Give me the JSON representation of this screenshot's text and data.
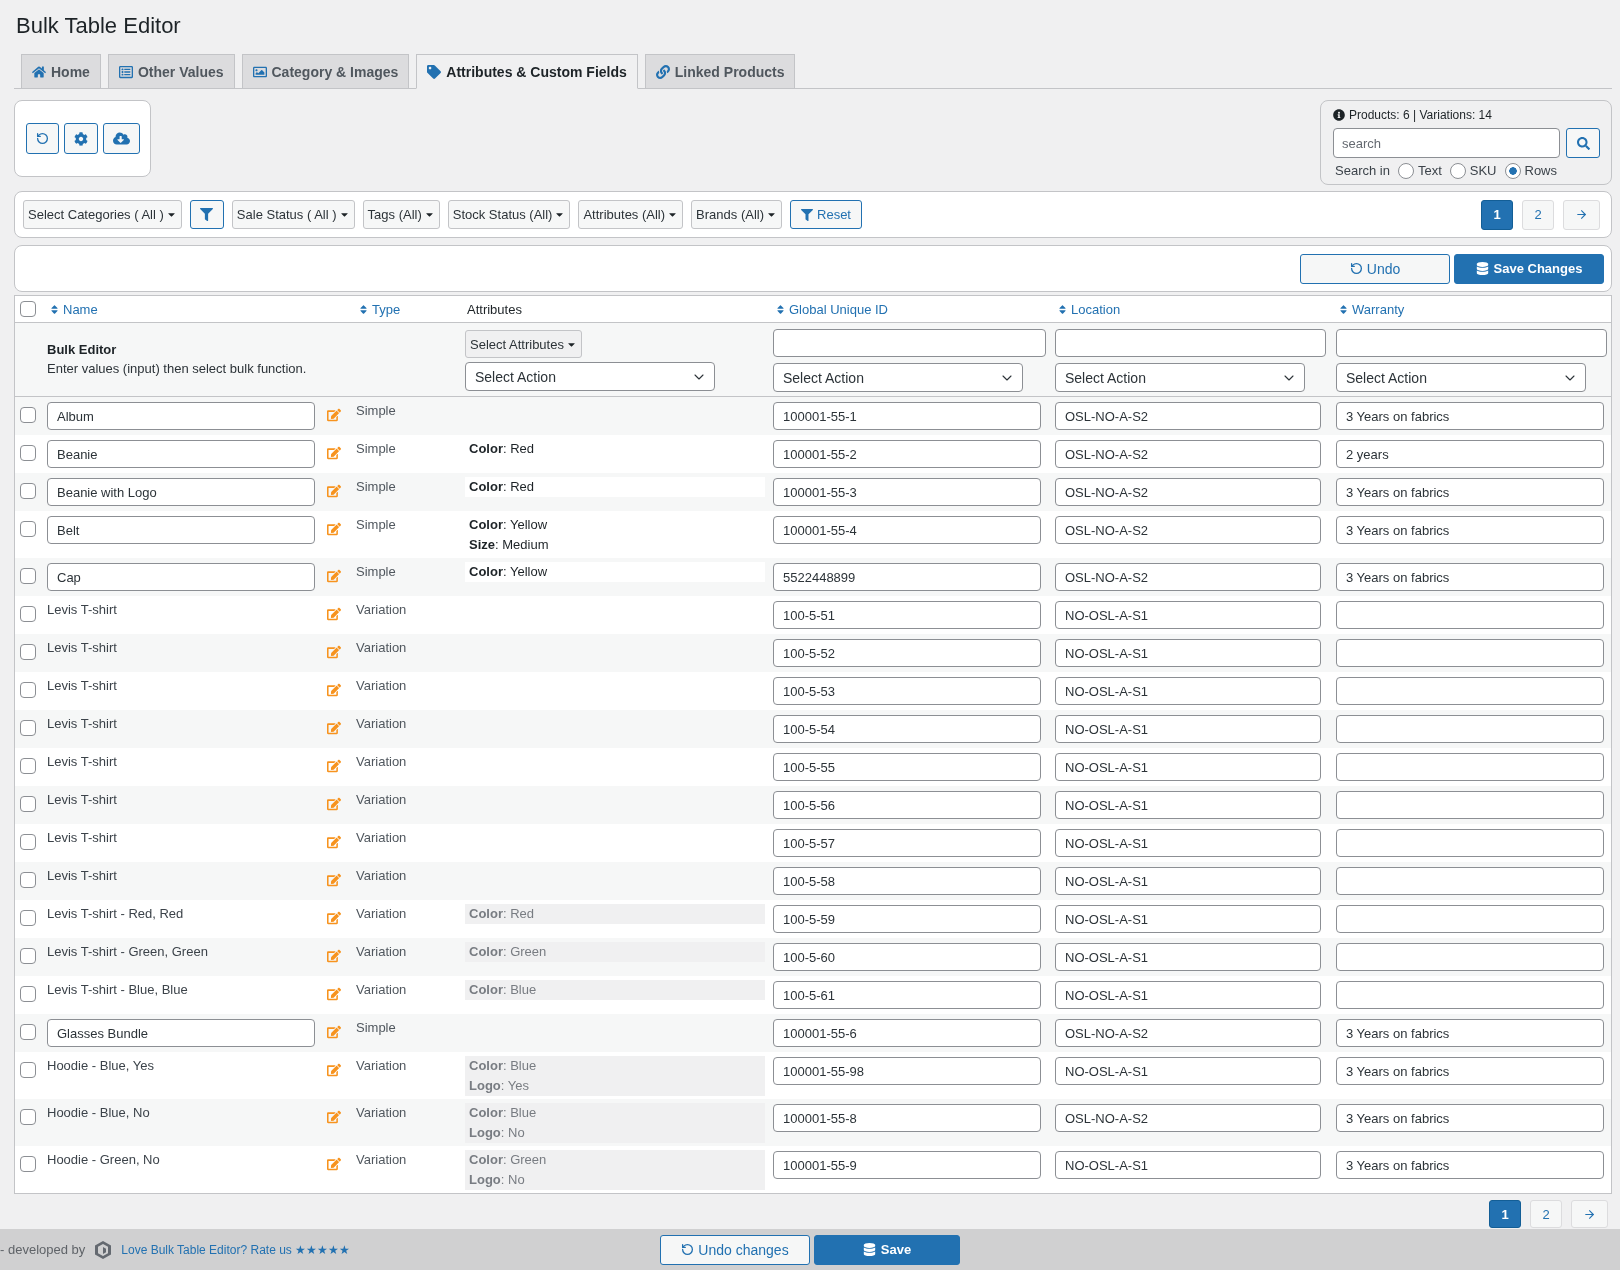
{
  "page": {
    "title": "Bulk Table Editor"
  },
  "tabs": [
    {
      "label": "Home",
      "selected": false
    },
    {
      "label": "Other Values",
      "selected": false
    },
    {
      "label": "Category & Images",
      "selected": false
    },
    {
      "label": "Attributes & Custom Fields",
      "selected": true
    },
    {
      "label": "Linked Products",
      "selected": false
    }
  ],
  "search_panel": {
    "summary": "Products: 6 | Variations: 14",
    "search_field": {
      "placeholder": "search"
    },
    "search_in_label": "Search in",
    "options": [
      {
        "label": "Text",
        "selected": false
      },
      {
        "label": "SKU",
        "selected": false
      },
      {
        "label": "Rows",
        "selected": true
      }
    ]
  },
  "filters": [
    {
      "kind": "dropdown",
      "label": "Select Categories ( All )"
    },
    {
      "kind": "filter"
    },
    {
      "kind": "dropdown",
      "label": "Sale Status ( All )"
    },
    {
      "kind": "dropdown",
      "label": "Tags (All)"
    },
    {
      "kind": "dropdown",
      "label": "Stock Status (All)"
    },
    {
      "kind": "dropdown",
      "label": "Attributes (All)"
    },
    {
      "kind": "dropdown",
      "label": "Brands (All)"
    },
    {
      "kind": "reset",
      "label": "Reset"
    }
  ],
  "pagination_top": {
    "pages": [
      {
        "label": "1",
        "selected": true
      },
      {
        "label": "2",
        "selected": false
      }
    ]
  },
  "actions": {
    "undo": "Undo",
    "save": "Save Changes"
  },
  "table": {
    "select_all": {
      "checked": false
    },
    "columns": [
      {
        "label": "Name",
        "sortable": true
      },
      {
        "label": "Type",
        "sortable": true
      },
      {
        "label": "Attributes",
        "sortable": false
      },
      {
        "label": "Global Unique ID",
        "sortable": true
      },
      {
        "label": "Location",
        "sortable": true
      },
      {
        "label": "Warranty",
        "sortable": true
      }
    ],
    "bulk_editor": {
      "title": "Bulk Editor",
      "hint": "Enter values (input) then select bulk function.",
      "columns": [
        {
          "kind": "attributes",
          "button": "Select Attributes",
          "action": "Select Action"
        },
        {
          "kind": "field",
          "action": "Select Action"
        },
        {
          "kind": "field",
          "action": "Select Action"
        },
        {
          "kind": "field",
          "action": "Select Action"
        }
      ]
    },
    "rows": [
      {
        "checked": false,
        "kind": "simple",
        "name": "Album",
        "type": "Simple",
        "global_unique_id": "100001-55-1",
        "location": "OSL-NO-A-S2",
        "warranty": "3 Years on fabrics"
      },
      {
        "checked": false,
        "kind": "simple",
        "name": "Beanie",
        "type": "Simple",
        "attributes": [
          "**Color**: Red"
        ],
        "global_unique_id": "100001-55-2",
        "location": "OSL-NO-A-S2",
        "warranty": "2 years"
      },
      {
        "checked": false,
        "kind": "simple",
        "name": "Beanie with Logo",
        "type": "Simple",
        "attributes": [
          "**Color**: Red"
        ],
        "global_unique_id": "100001-55-3",
        "location": "OSL-NO-A-S2",
        "warranty": "3 Years on fabrics"
      },
      {
        "checked": false,
        "kind": "simple",
        "name": "Belt",
        "type": "Simple",
        "attributes": [
          "**Color**: Yellow",
          "**Size**: Medium"
        ],
        "global_unique_id": "100001-55-4",
        "location": "OSL-NO-A-S2",
        "warranty": "3 Years on fabrics"
      },
      {
        "checked": false,
        "kind": "simple",
        "name": "Cap",
        "type": "Simple",
        "attributes": [
          "**Color**: Yellow"
        ],
        "global_unique_id": "5522448899",
        "location": "OSL-NO-A-S2",
        "warranty": "3 Years on fabrics"
      },
      {
        "checked": false,
        "kind": "variation",
        "name": "Levis T-shirt",
        "type": "Variation",
        "global_unique_id": "100-5-51",
        "location": "NO-OSL-A-S1"
      },
      {
        "checked": false,
        "kind": "variation",
        "name": "Levis T-shirt",
        "type": "Variation",
        "global_unique_id": "100-5-52",
        "location": "NO-OSL-A-S1"
      },
      {
        "checked": false,
        "kind": "variation",
        "name": "Levis T-shirt",
        "type": "Variation",
        "global_unique_id": "100-5-53",
        "location": "NO-OSL-A-S1"
      },
      {
        "checked": false,
        "kind": "variation",
        "name": "Levis T-shirt",
        "type": "Variation",
        "global_unique_id": "100-5-54",
        "location": "NO-OSL-A-S1"
      },
      {
        "checked": false,
        "kind": "variation",
        "name": "Levis T-shirt",
        "type": "Variation",
        "global_unique_id": "100-5-55",
        "location": "NO-OSL-A-S1"
      },
      {
        "checked": false,
        "kind": "variation",
        "name": "Levis T-shirt",
        "type": "Variation",
        "global_unique_id": "100-5-56",
        "location": "NO-OSL-A-S1"
      },
      {
        "checked": false,
        "kind": "variation",
        "name": "Levis T-shirt",
        "type": "Variation",
        "global_unique_id": "100-5-57",
        "location": "NO-OSL-A-S1"
      },
      {
        "checked": false,
        "kind": "variation",
        "name": "Levis T-shirt",
        "type": "Variation",
        "global_unique_id": "100-5-58",
        "location": "NO-OSL-A-S1"
      },
      {
        "checked": false,
        "kind": "variation",
        "name": "Levis T-shirt - Red, Red",
        "type": "Variation",
        "attributes": [
          "**Color**: Red"
        ],
        "global_unique_id": "100-5-59",
        "location": "NO-OSL-A-S1"
      },
      {
        "checked": false,
        "kind": "variation",
        "name": "Levis T-shirt - Green, Green",
        "type": "Variation",
        "attributes": [
          "**Color**: Green"
        ],
        "global_unique_id": "100-5-60",
        "location": "NO-OSL-A-S1"
      },
      {
        "checked": false,
        "kind": "variation",
        "name": "Levis T-shirt - Blue, Blue",
        "type": "Variation",
        "attributes": [
          "**Color**: Blue"
        ],
        "global_unique_id": "100-5-61",
        "location": "NO-OSL-A-S1"
      },
      {
        "checked": false,
        "kind": "simple",
        "name": "Glasses Bundle",
        "type": "Simple",
        "global_unique_id": "100001-55-6",
        "location": "OSL-NO-A-S2",
        "warranty": "3 Years on fabrics"
      },
      {
        "checked": false,
        "kind": "variation",
        "name": "Hoodie - Blue, Yes",
        "type": "Variation",
        "attributes": [
          "**Color**: Blue",
          "**Logo**: Yes"
        ],
        "global_unique_id": "100001-55-98",
        "location": "NO-OSL-A-S1",
        "warranty": "3 Years on fabrics"
      },
      {
        "checked": false,
        "kind": "variation",
        "name": "Hoodie - Blue, No",
        "type": "Variation",
        "attributes": [
          "**Color**: Blue",
          "**Logo**: No"
        ],
        "global_unique_id": "100001-55-8",
        "location": "OSL-NO-A-S2",
        "warranty": "3 Years on fabrics"
      },
      {
        "checked": false,
        "kind": "variation",
        "name": "Hoodie - Green, No",
        "type": "Variation",
        "attributes": [
          "**Color**: Green",
          "**Logo**: No"
        ],
        "global_unique_id": "100001-55-9",
        "location": "NO-OSL-A-S1",
        "warranty": "3 Years on fabrics"
      }
    ]
  },
  "pagination_bottom": {
    "pages": [
      {
        "label": "1",
        "selected": true
      },
      {
        "label": "2",
        "selected": false
      }
    ]
  },
  "footer": {
    "credit": "- developed by",
    "rate_link": "Love Bulk Table Editor? Rate us ★★★★★",
    "undo": "Undo changes",
    "save": "Save"
  }
}
